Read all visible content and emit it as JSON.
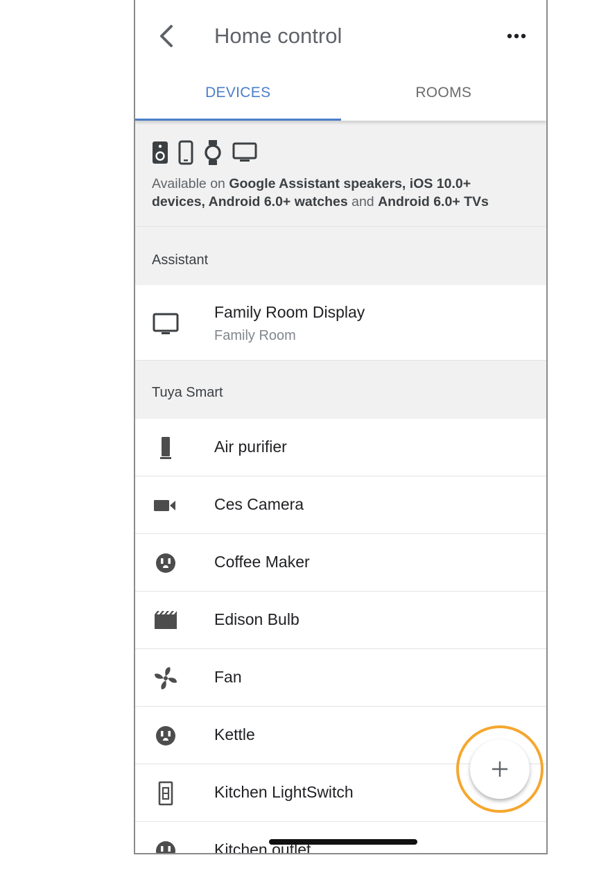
{
  "header": {
    "title": "Home control",
    "back_icon": "chevron-left-icon",
    "more_icon": "more-horiz-icon"
  },
  "tabs": [
    {
      "label": "DEVICES",
      "selected": true
    },
    {
      "label": "ROOMS",
      "selected": false
    }
  ],
  "availability": {
    "icons": [
      "speaker-icon",
      "phone-icon",
      "watch-icon",
      "tv-icon"
    ],
    "prefix": "Available on ",
    "part1": "Google Assistant speakers, iOS 10.0+",
    "part2": "devices, Android 6.0+ watches",
    "and": " and ",
    "part3": "Android 6.0+ TVs"
  },
  "sections": [
    {
      "label": "Assistant",
      "devices": [
        {
          "name": "Family Room Display",
          "room": "Family Room",
          "icon": "display-icon"
        }
      ]
    },
    {
      "label": "Tuya Smart",
      "devices": [
        {
          "name": "Air purifier",
          "icon": "air-purifier-icon"
        },
        {
          "name": "Ces Camera",
          "icon": "camera-icon"
        },
        {
          "name": "Coffee Maker",
          "icon": "outlet-icon"
        },
        {
          "name": "Edison Bulb",
          "icon": "scene-icon"
        },
        {
          "name": "Fan",
          "icon": "fan-icon"
        },
        {
          "name": "Kettle",
          "icon": "outlet-icon"
        },
        {
          "name": "Kitchen LightSwitch",
          "icon": "light-switch-icon"
        },
        {
          "name": "Kitchen outlet",
          "icon": "outlet-icon"
        }
      ]
    }
  ],
  "fab": {
    "icon": "plus-icon",
    "highlight_color": "#f5a730"
  },
  "colors": {
    "accent": "#4a7fc8",
    "background": "#f1f1f1"
  }
}
